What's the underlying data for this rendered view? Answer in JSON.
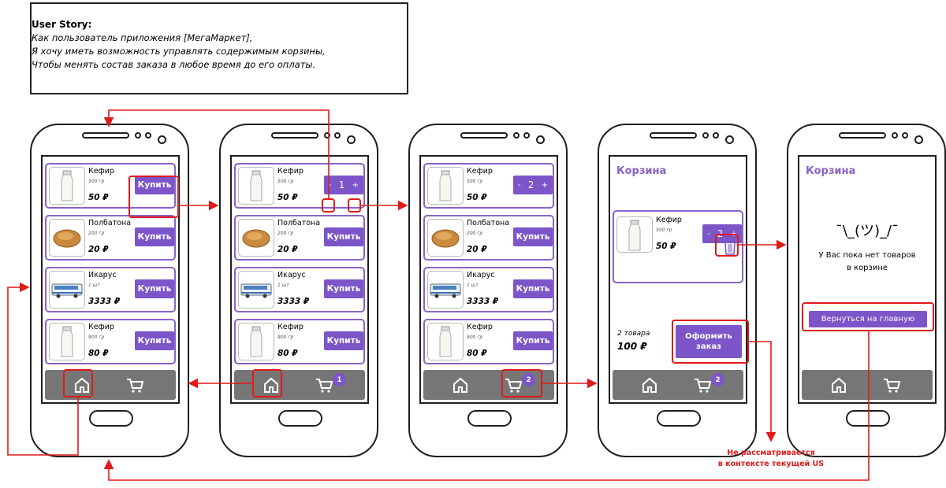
{
  "user_story": {
    "title": "User Story:",
    "lines": [
      "Как пользователь приложения [МегаМаркет],",
      "Я хочу иметь возможность управлять содержимым корзины,",
      "Чтобы менять состав заказа в любое время до его оплаты."
    ]
  },
  "products": [
    {
      "name": "Кефир",
      "weight": "500 гр",
      "price": "50 ₽",
      "image": "milk-bottle"
    },
    {
      "name": "Полбатона",
      "weight": "200 гр",
      "price": "20 ₽",
      "image": "bread"
    },
    {
      "name": "Икарус",
      "weight": "1 шт",
      "price": "3333 ₽",
      "image": "bus"
    },
    {
      "name": "Кефир",
      "weight": "900 гр",
      "price": "80 ₽",
      "image": "milk-bottle"
    }
  ],
  "buy_label": "Купить",
  "qty_controls": {
    "minus": "-",
    "plus": "+"
  },
  "screen2": {
    "qty": "1",
    "cart_badge": "1"
  },
  "screen3": {
    "qty": "2",
    "cart_badge": "2"
  },
  "cart": {
    "title": "Корзина",
    "item": {
      "name": "Кефир",
      "weight": "500 гр",
      "price": "50 ₽",
      "qty": "2"
    },
    "summary_count": "2 товара",
    "summary_total": "100 ₽",
    "checkout_line1": "Оформить",
    "checkout_line2": "заказ",
    "cart_badge": "2"
  },
  "empty_cart": {
    "title": "Корзина",
    "shrug": "¯\\_(ツ)_/¯",
    "message_line1": "У Вас пока нет товаров",
    "message_line2": "в корзине",
    "back_button": "Вернуться на главную"
  },
  "note": {
    "line1": "Не рассматривается",
    "line2": "в контексте текущей US"
  },
  "colors": {
    "accent": "#7c55c9",
    "card_border": "#8a63c8",
    "navbar": "#767676",
    "annotation": "#e01a1a"
  },
  "icons": {
    "home": "home-icon",
    "cart": "cart-icon",
    "trash": "trash-icon"
  }
}
